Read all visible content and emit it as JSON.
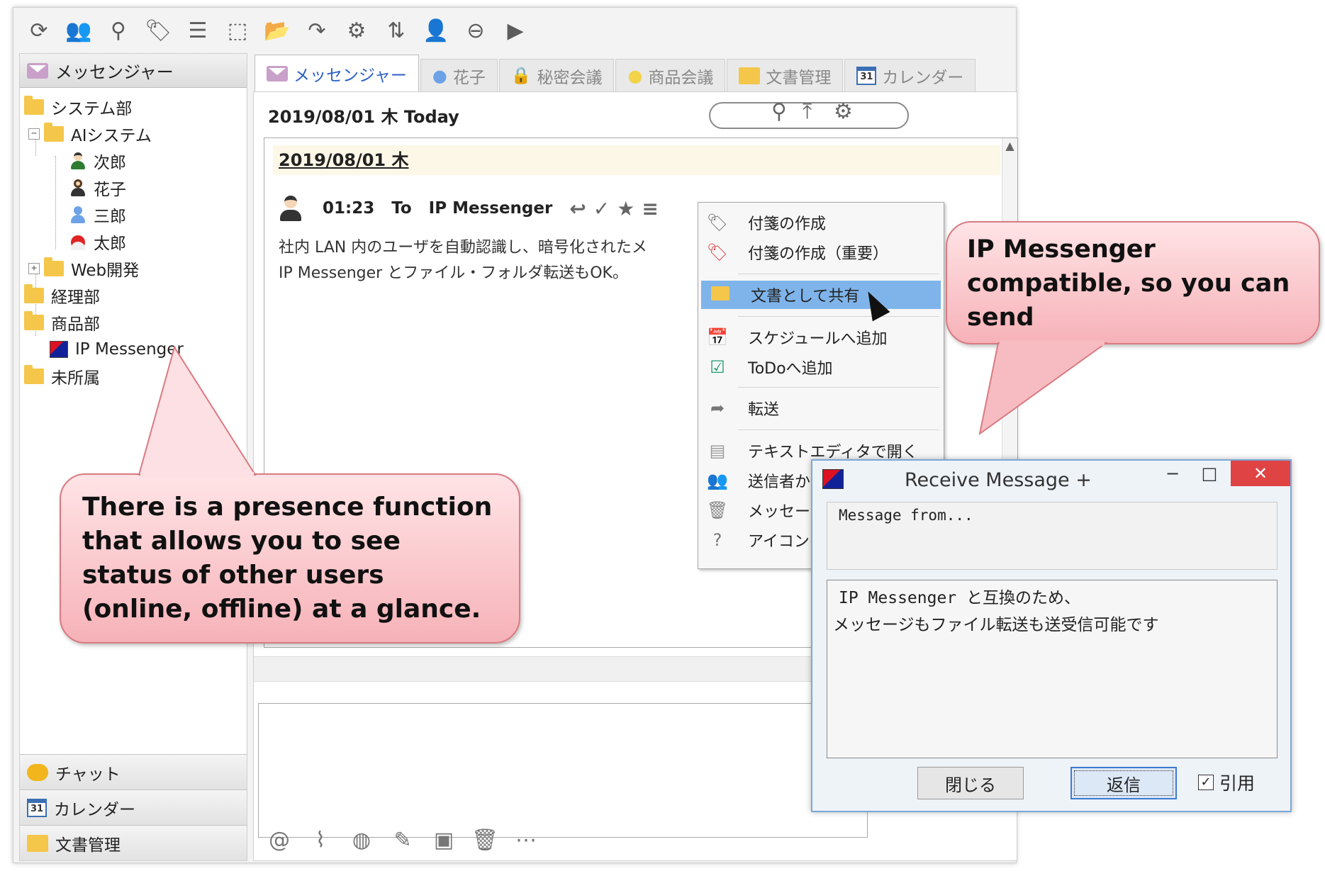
{
  "toolbar": {
    "icons": [
      "refresh-icon",
      "users-group-icon",
      "user-search-icon",
      "tag-icon",
      "select-list-icon",
      "select-area-icon",
      "open-folder-icon",
      "redo-icon",
      "gear-icon",
      "sort-icon",
      "user-sort-icon",
      "user-remove-icon",
      "video-icon"
    ]
  },
  "left_panel": {
    "header": "メッセンジャー",
    "tree": {
      "system_dept": "システム部",
      "ai_system": "AIシステム",
      "jiro": "次郎",
      "hanako": "花子",
      "saburo": "三郎",
      "taro": "太郎",
      "web_dev": "Web開発",
      "accounting": "経理部",
      "product_dept": "商品部",
      "ip_messenger": "IP Messenger",
      "unassigned": "未所属"
    },
    "bottom": {
      "chat": "チャット",
      "calendar": "カレンダー",
      "calendar_icon_text": "31",
      "documents": "文書管理"
    }
  },
  "tabs": [
    {
      "label": "メッセンジャー"
    },
    {
      "label": "花子"
    },
    {
      "label": "秘密会議"
    },
    {
      "label": "商品会議"
    },
    {
      "label": "文書管理"
    },
    {
      "label": "カレンダー",
      "icon_text": "31"
    }
  ],
  "main": {
    "date_label": "2019/08/01 木 Today",
    "search_value": "",
    "day_header": "2019/08/01 木",
    "message": {
      "time": "01:23",
      "to": "To",
      "recipient": "IP Messenger",
      "line1": "社内 LAN 内のユーザを自動認識し、暗号化されたメ",
      "line2": "IP Messenger とファイル・フォルダ転送もOK。"
    }
  },
  "context_menu": {
    "sticky_note": "付箋の作成",
    "sticky_note_important": "付箋の作成（重要）",
    "share_as_document": "文書として共有",
    "add_schedule": "スケジュールへ追加",
    "add_todo": "ToDoへ追加",
    "forward": "転送",
    "open_in_editor": "テキストエディタで開く",
    "from_sender": "送信者から",
    "message_item": "メッセージ",
    "icon_item": "アイコンの"
  },
  "dialog": {
    "title": "Receive Message +",
    "minimize": "−",
    "maximize": "□",
    "close": "✕",
    "from_label": "Message from...",
    "body_line1": "IP Messenger と互換のため、",
    "body_line2": "メッセージもファイル転送も送受信可能です",
    "close_button": "閉じる",
    "reply_button": "返信",
    "quote_checkbox": "引用",
    "quote_checked": true
  },
  "callouts": {
    "left": "There is a presence function that allows you to see status of other users (online, offline) at a glance.",
    "right": "IP Messenger compatible, so you can send"
  },
  "colors": {
    "accent_blue": "#2b5fc4",
    "selection": "#7fb4ea",
    "callout": "#f6b2b8",
    "close_red": "#e04343"
  }
}
